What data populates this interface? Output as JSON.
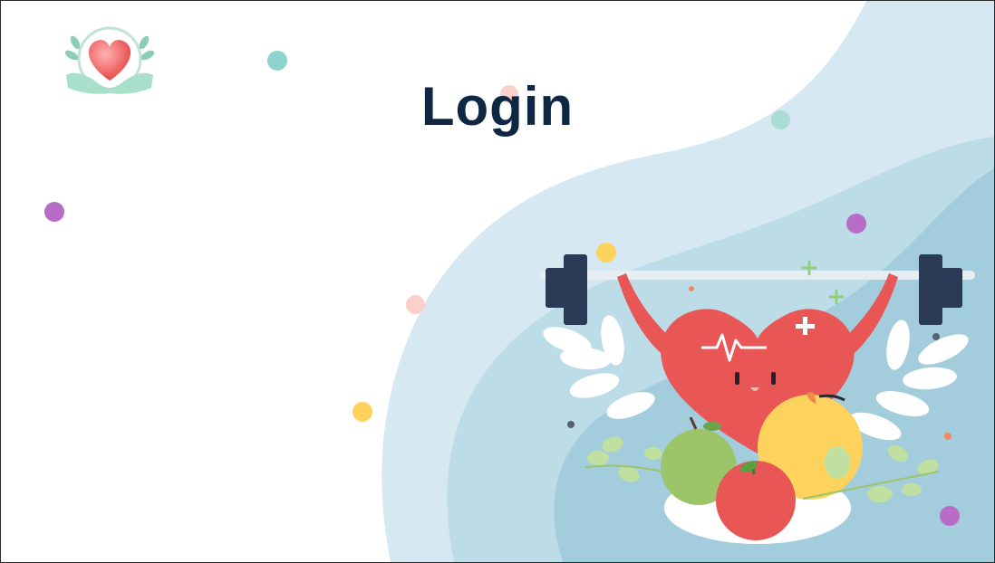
{
  "page": {
    "title": "Login"
  },
  "logo": {
    "icon": "heart-hands-logo"
  },
  "illustration": {
    "icon": "heart-weightlifting-fruits-illustration"
  },
  "colors": {
    "title": "#0e2843",
    "wave_light": "#d6e8f1",
    "wave_mid": "#bcdce8",
    "wave_dark": "#a3ccdc",
    "heart": "#e85656",
    "barbell_plate": "#2a3a57",
    "dot_teal": "#8fd3cf",
    "dot_purple": "#b96cc5",
    "dot_yellow": "#fdd35e",
    "dot_peach": "#f9d1c8"
  }
}
